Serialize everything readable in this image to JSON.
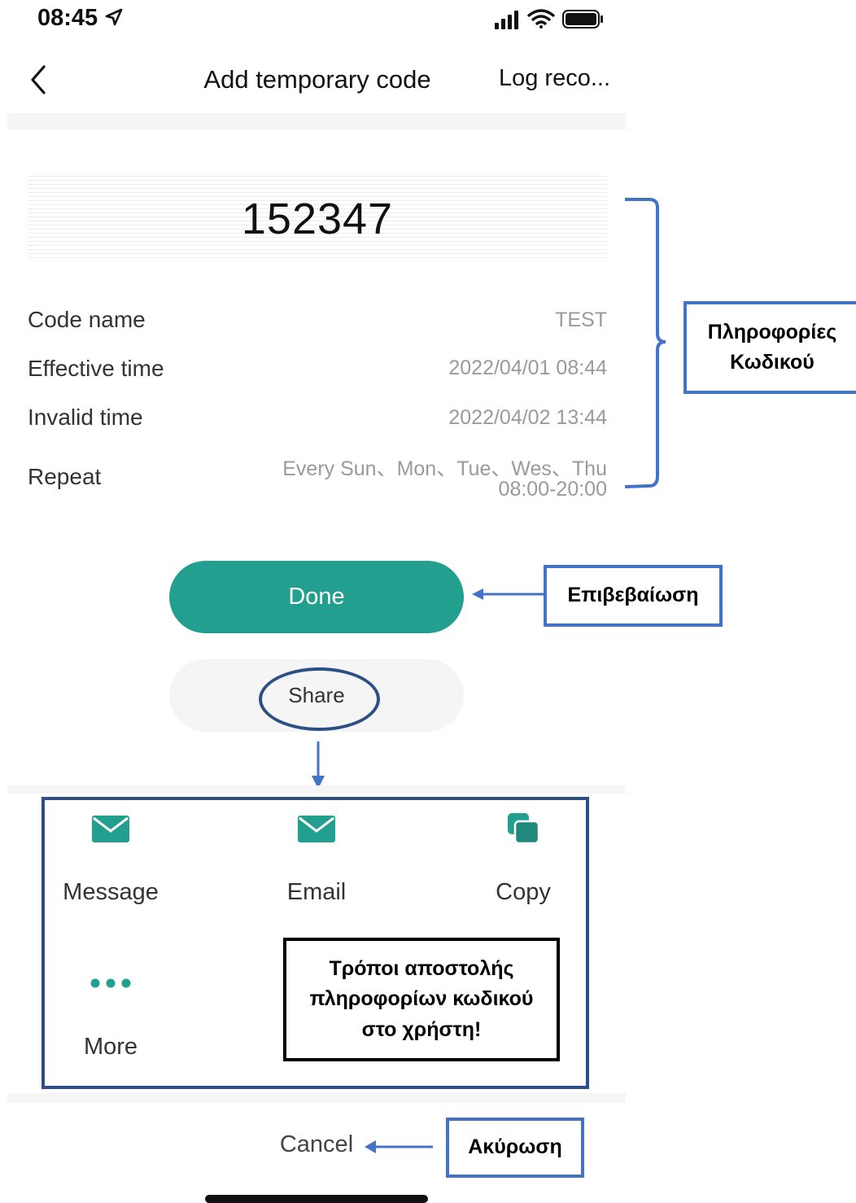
{
  "status_bar": {
    "time": "08:45"
  },
  "nav": {
    "title": "Add temporary code",
    "right_action": "Log reco..."
  },
  "code": {
    "value": "152347"
  },
  "details": {
    "code_name_label": "Code name",
    "code_name_value": "TEST",
    "effective_label": "Effective time",
    "effective_value": "2022/04/01 08:44",
    "invalid_label": "Invalid time",
    "invalid_value": "2022/04/02 13:44",
    "repeat_label": "Repeat",
    "repeat_days": "Every Sun、Mon、Tue、Wes、Thu",
    "repeat_hours": "08:00-20:00"
  },
  "actions": {
    "done": "Done",
    "share": "Share",
    "cancel": "Cancel"
  },
  "share_options": {
    "message": "Message",
    "email": "Email",
    "copy": "Copy",
    "more": "More"
  },
  "annotations": {
    "code_info_line1": "Πληροφορίες",
    "code_info_line2": "Κωδικού",
    "confirm": "Επιβεβαίωση",
    "send_methods_line1": "Τρόποι αποστολής",
    "send_methods_line2": "πληροφορίων κωδικού",
    "send_methods_line3": "στο χρήστη!",
    "cancel": "Ακύρωση"
  },
  "colors": {
    "accent": "#239f8f",
    "annotation_blue": "#4472c4",
    "frame_navy": "#2e4f86"
  }
}
